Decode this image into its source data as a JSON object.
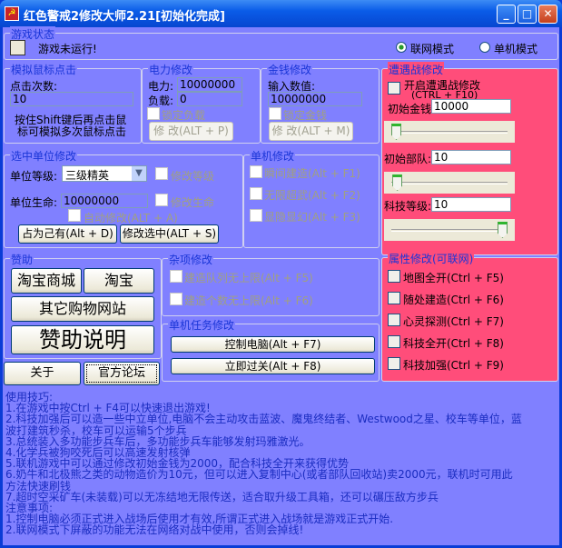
{
  "window": {
    "title": "红色警戒2修改大师2.21[初始化完成]",
    "icon": "ra2-icon",
    "min": "_",
    "max": "□",
    "close": "✕"
  },
  "game_status": {
    "title": "游戏状态",
    "status": "游戏未运行!",
    "mode_online": "联网模式",
    "mode_single": "单机模式",
    "selected_mode": "联网模式"
  },
  "mouse": {
    "title": "模拟鼠标点击",
    "count_label": "点击次数:",
    "count_value": "10",
    "hint1": "按住Shift键后再点击鼠",
    "hint2": "标可模拟多次鼠标点击"
  },
  "power": {
    "title": "电力修改",
    "power_label": "电力:",
    "power_value": "10000000",
    "load_label": "负载:",
    "load_value": "0",
    "lock_label": "锁定负载",
    "button": "修 改(ALT + P)"
  },
  "money": {
    "title": "金钱修改",
    "input_label": "输入数值:",
    "input_value": "10000000",
    "lock_label": "锁定金钱",
    "button": "修 改(ALT + M)"
  },
  "skirmish": {
    "title": "遭遇战修改",
    "enable_label": "开启遭遇战修改",
    "enable_hotkey": "(CTRL + F10)",
    "money_label": "初始金钱",
    "money_value": "10000",
    "money_slider": 0.0,
    "units_label": "初始部队:",
    "units_value": "10",
    "units_slider": 0.01,
    "tech_label": "科技等级:",
    "tech_value": "10",
    "tech_slider": 1.0
  },
  "attributes": {
    "title": "属性修改(可联网)",
    "items": [
      "地图全开(Ctrl + F5)",
      "随处建造(Ctrl + F6)",
      "心灵探测(Ctrl + F7)",
      "科技全开(Ctrl + F8)",
      "科技加强(Ctrl + F9)"
    ]
  },
  "unit": {
    "title": "选中单位修改",
    "level_label": "单位等级:",
    "level_value": "三级精英",
    "mod_level": "修改等级",
    "hp_label": "单位生命:",
    "hp_value": "10000000",
    "mod_hp": "修改生命",
    "auto": "自动修改(ALT + A)",
    "own_button": "占为己有(Alt + D)",
    "modify_button": "修改选中(ALT + S)"
  },
  "single": {
    "title": "单机修改",
    "items": [
      "瞬间建造(Alt + F1)",
      "无限超武(Alt + F2)",
      "显隐显幻(Alt + F3)"
    ]
  },
  "sponsor": {
    "title": "赞助",
    "taobao_mall": "淘宝商城",
    "taobao": "淘宝",
    "other_shops": "其它购物网站",
    "sponsor_info": "赞助说明",
    "about": "关于",
    "forum": "官方论坛"
  },
  "misc": {
    "title": "杂项修改",
    "items": [
      "建造队列无上限(Alt + F5)",
      "建造个数无上限(Alt + F6)"
    ]
  },
  "mission": {
    "title": "单机任务修改",
    "control_pc": "控制电脑(Alt + F7)",
    "win_now": "立即过关(Alt + F8)"
  },
  "tips": [
    "使用技巧:",
    "1.在游戏中按Ctrl + F4可以快速退出游戏!",
    "2.科技加强后可以造一些中立单位,电脑不会主动攻击蓝波、魔鬼终结者、Westwood之星、校车等单位，蓝",
    "波打建筑秒杀，校车可以运输5个步兵",
    "3.总统装入多功能步兵车后，多功能步兵车能够发射玛雅激光。",
    "4.化学兵被狗咬死后可以高速发射核弹",
    "5.联机游戏中可以通过修改初始金钱为2000，配合科技全开来获得优势",
    "6.奶牛和北极熊之类的动物造价为10元，但可以进入复制中心(或者部队回收站)卖2000元，联机时可用此",
    "方法快速刷钱",
    "7.超时空采矿车(未装载)可以无冻结地无限传送，适合取升级工具箱，还可以碾压敌方步兵",
    "注意事项:",
    "1.控制电脑必须正式进入战场后使用才有效,所谓正式进入战场就是游戏正式开始.",
    "2.联网模式下屏蔽的功能无法在网络对战中使用，否则会掉线!"
  ]
}
